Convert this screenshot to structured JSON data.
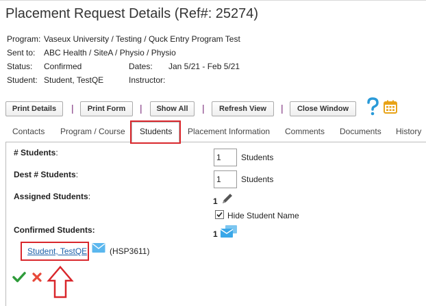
{
  "page": {
    "title": "Placement Request Details (Ref#: 25274)"
  },
  "info": {
    "program_label": "Program:",
    "program_value": "Vaseux University / Testing / Quck Entry Program Test",
    "sent_label": "Sent to:",
    "sent_value": "ABC Health / SiteA / Physio / Physio",
    "status_label": "Status:",
    "status_value": "Confirmed",
    "dates_label": "Dates:",
    "dates_value": "Jan 5/21 - Feb 5/21",
    "student_label": "Student:",
    "student_value": "Student, TestQE",
    "instructor_label": "Instructor:"
  },
  "toolbar": {
    "print_details": "Print Details",
    "print_form": "Print Form",
    "show_all": "Show All",
    "refresh_view": "Refresh View",
    "close_window": "Close Window",
    "separator": "|",
    "help_icon": "question-mark-icon",
    "calendar_icon": "calendar-icon"
  },
  "tabs": [
    {
      "label": "Contacts"
    },
    {
      "label": "Program / Course"
    },
    {
      "label": "Students",
      "active": true
    },
    {
      "label": "Placement Information"
    },
    {
      "label": "Comments"
    },
    {
      "label": "Documents"
    },
    {
      "label": "History"
    }
  ],
  "students": {
    "num_label": "# Students",
    "num_suffix": ":",
    "num_value": "1",
    "num_unit": "Students",
    "dest_label": "Dest # Students",
    "dest_suffix": ":",
    "dest_value": "1",
    "dest_unit": "Students",
    "assigned_label": "Assigned Students",
    "assigned_suffix": ":",
    "assigned_count": "1",
    "hide_name_label": "Hide Student Name",
    "confirmed_label": "Confirmed Students:",
    "confirmed_count": "1",
    "student_link": "Student, TestQE",
    "student_code": "(HSP3611)"
  },
  "colors": {
    "accent_red": "#d9262b",
    "link_blue": "#1a5fa8",
    "check_green": "#2e9b3a",
    "icon_blue": "#3aa7e8",
    "calendar_gold": "#e8a317"
  }
}
